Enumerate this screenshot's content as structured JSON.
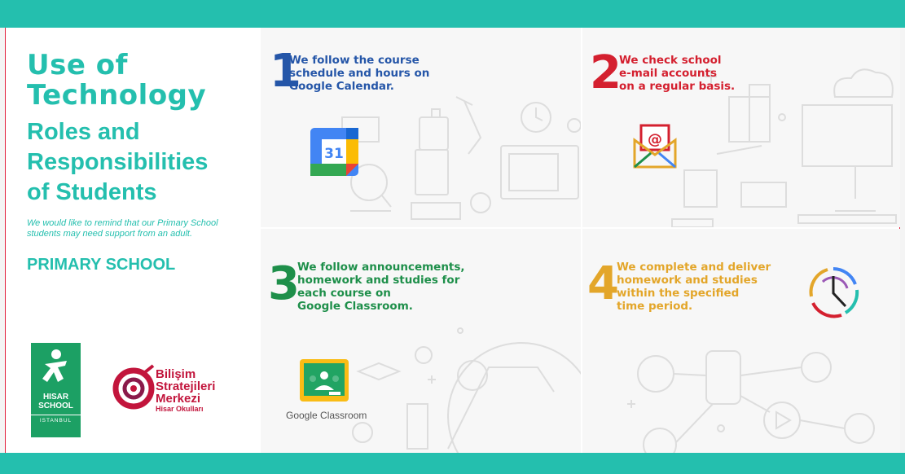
{
  "title_lines": [
    "Use of",
    "Technology"
  ],
  "subtitle_lines": [
    "Roles and",
    "Responsibilities",
    "of Students"
  ],
  "reminder": "We would like to remind that our Primary School students may need support from an adult.",
  "primary": "PRIMARY SCHOOL",
  "colors": {
    "teal": "#24bfae",
    "blue": "#2556a8",
    "red": "#d4202f",
    "green": "#1e8f4a",
    "gold": "#e3a62a"
  },
  "steps": [
    {
      "number": "1",
      "lines": [
        "We follow the course",
        "schedule and hours on",
        "Google Calendar."
      ]
    },
    {
      "number": "2",
      "lines": [
        "We check school",
        "e-mail accounts",
        "on a regular basis."
      ]
    },
    {
      "number": "3",
      "lines": [
        "We follow announcements,",
        "homework and studies for",
        "each course on",
        "Google Classroom."
      ]
    },
    {
      "number": "4",
      "lines": [
        "We complete and deliver",
        "homework and studies",
        "within the specified",
        "time period."
      ]
    }
  ],
  "calendar": {
    "day": "31",
    "icon": "google-calendar-icon"
  },
  "gmail": {
    "icon": "email-envelope-icon"
  },
  "classroom": {
    "label": "Google Classroom",
    "icon": "google-classroom-icon"
  },
  "clock": {
    "icon": "clock-icon"
  },
  "hisar": {
    "name_lines": [
      "HISAR",
      "SCHOOL"
    ],
    "city": "ISTANBUL"
  },
  "bsm": {
    "lines": [
      "Bilişim",
      "Stratejileri",
      "Merkezi"
    ],
    "sub": "Hisar Okulları"
  }
}
